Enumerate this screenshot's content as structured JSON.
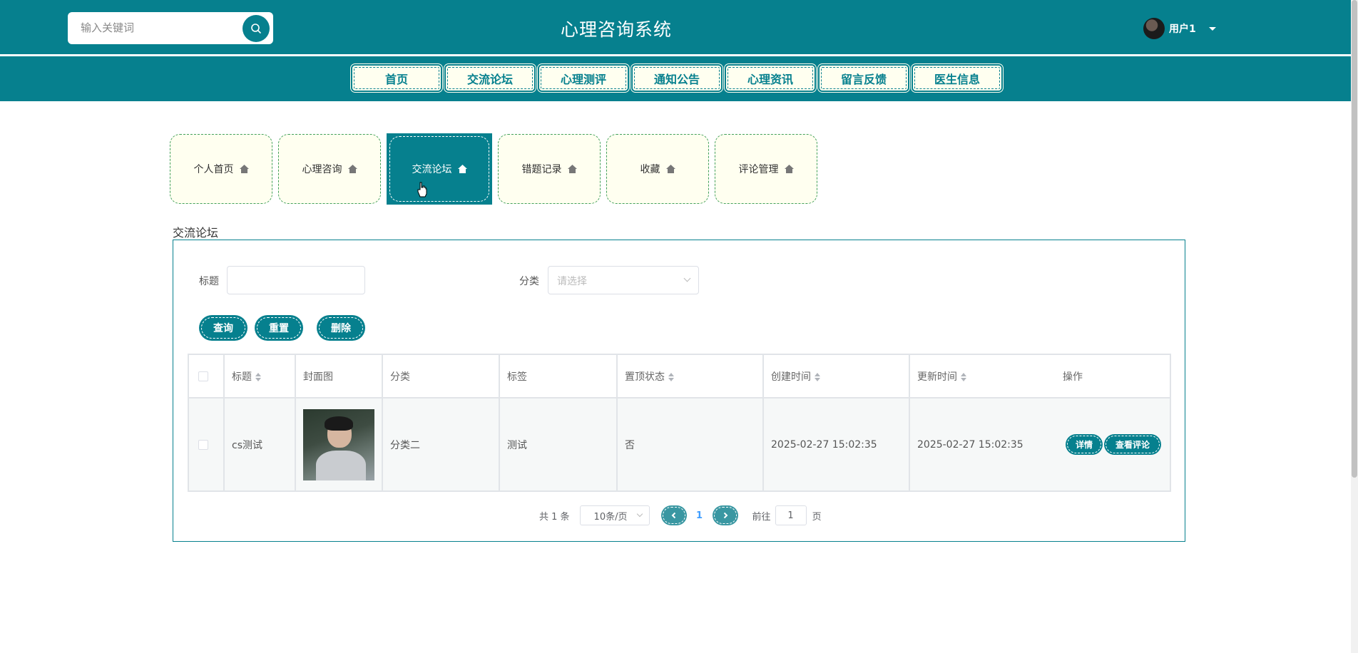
{
  "header": {
    "search_placeholder": "输入关键词",
    "site_title": "心理咨询系统",
    "username": "用户1"
  },
  "nav": [
    "首页",
    "交流论坛",
    "心理测评",
    "通知公告",
    "心理资讯",
    "留言反馈",
    "医生信息"
  ],
  "tabs": [
    {
      "label": "个人首页",
      "active": false
    },
    {
      "label": "心理咨询",
      "active": false
    },
    {
      "label": "交流论坛",
      "active": true
    },
    {
      "label": "错题记录",
      "active": false
    },
    {
      "label": "收藏",
      "active": false
    },
    {
      "label": "评论管理",
      "active": false
    }
  ],
  "section_title": "交流论坛",
  "filters": {
    "title_label": "标题",
    "title_value": "",
    "category_label": "分类",
    "category_placeholder": "请选择"
  },
  "actions": {
    "query": "查询",
    "reset": "重置",
    "delete": "删除"
  },
  "table": {
    "columns": [
      "标题",
      "封面图",
      "分类",
      "标签",
      "置顶状态",
      "创建时间",
      "更新时间",
      "操作"
    ],
    "rows": [
      {
        "title": "cs测试",
        "category": "分类二",
        "tag": "测试",
        "pinned": "否",
        "created": "2025-02-27 15:02:35",
        "updated": "2025-02-27 15:02:35",
        "detail_label": "详情",
        "comments_label": "查看评论"
      }
    ]
  },
  "pagination": {
    "total_text": "共 1 条",
    "page_size": "10条/页",
    "current_page": "1",
    "goto_prefix": "前往",
    "goto_value": "1",
    "goto_suffix": "页"
  },
  "colors": {
    "primary": "#06808e",
    "tab_bg": "#fffff0",
    "link": "#409eff"
  }
}
